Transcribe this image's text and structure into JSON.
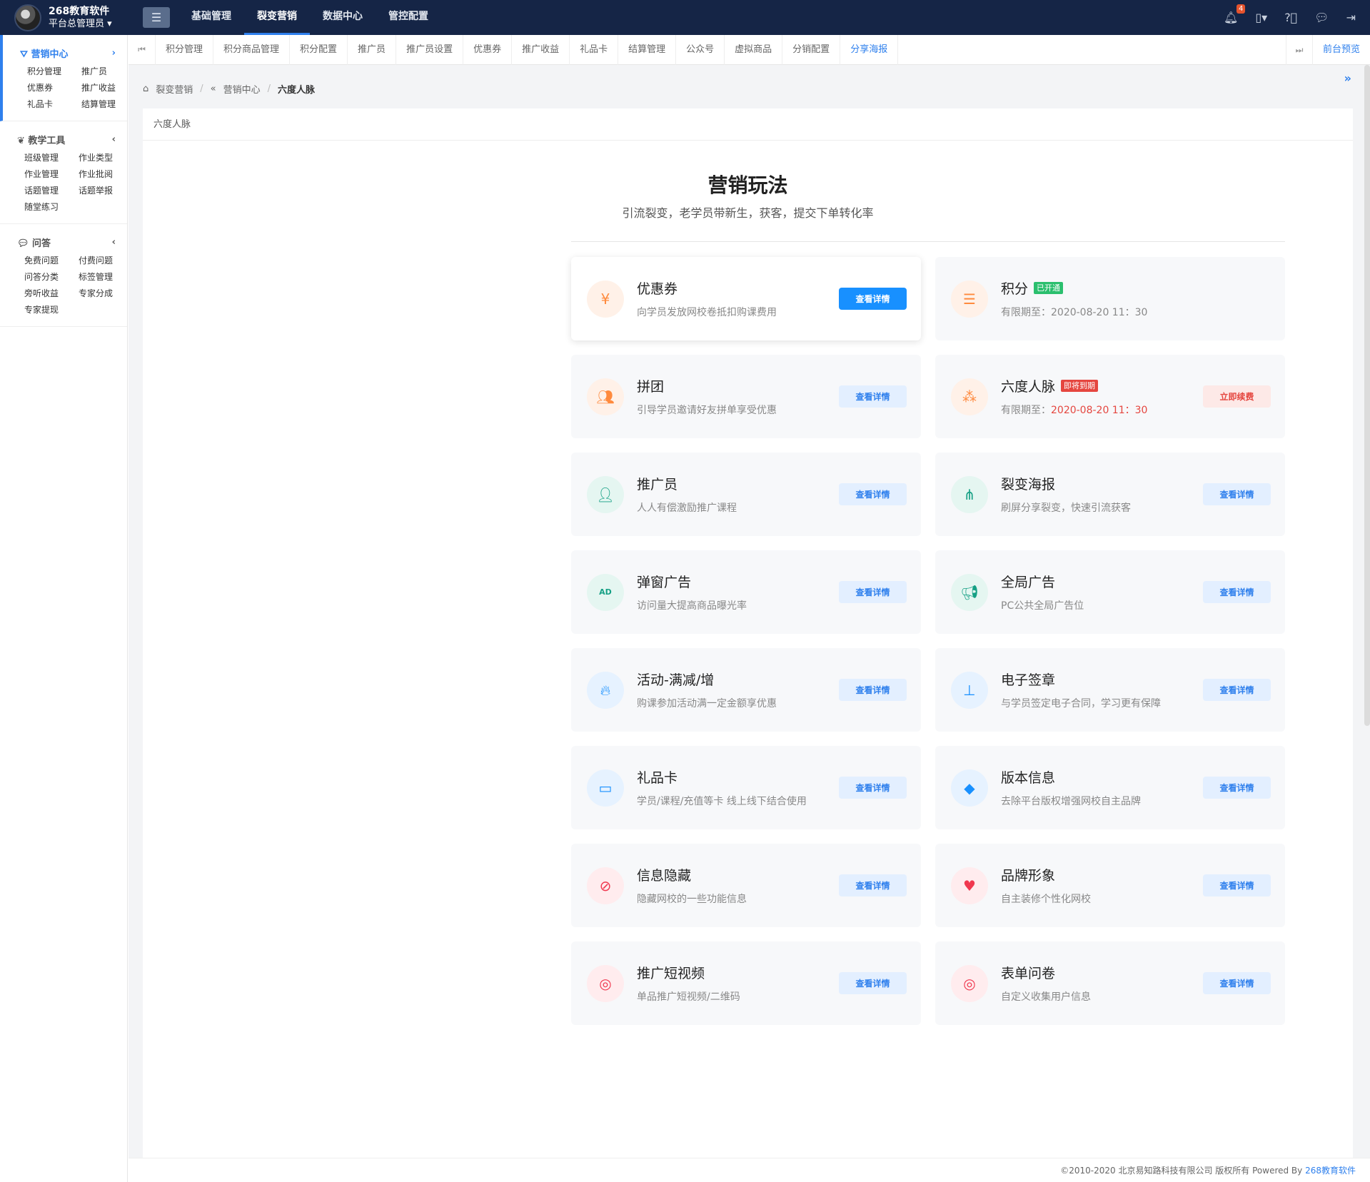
{
  "header": {
    "app_name": "268教育软件",
    "user_role": "平台总管理员",
    "nav": [
      {
        "label": "基础管理",
        "active": false
      },
      {
        "label": "裂变营销",
        "active": true
      },
      {
        "label": "数据中心",
        "active": false
      },
      {
        "label": "管控配置",
        "active": false
      }
    ],
    "notification_count": "4"
  },
  "sidebar": {
    "sections": [
      {
        "title": "营销中心",
        "icon": "funnel-icon",
        "active": true,
        "items": [
          "积分管理",
          "推广员",
          "优惠券",
          "推广收益",
          "礼品卡",
          "结算管理"
        ]
      },
      {
        "title": "教学工具",
        "icon": "leaf-icon",
        "active": false,
        "items": [
          "班级管理",
          "作业类型",
          "作业管理",
          "作业批阅",
          "话题管理",
          "话题举报",
          "随堂练习"
        ]
      },
      {
        "title": "问答",
        "icon": "chat-icon",
        "active": false,
        "items": [
          "免费问题",
          "付费问题",
          "问答分类",
          "标签管理",
          "旁听收益",
          "专家分成",
          "专家提现"
        ]
      }
    ]
  },
  "tabs": {
    "items": [
      "积分管理",
      "积分商品管理",
      "积分配置",
      "推广员",
      "推广员设置",
      "优惠券",
      "推广收益",
      "礼品卡",
      "结算管理",
      "公众号",
      "虚拟商品",
      "分销配置",
      "分享海报"
    ],
    "active_index": 12,
    "preview_label": "前台预览"
  },
  "breadcrumb": {
    "items": [
      "裂变营销",
      "营销中心"
    ],
    "current": "六度人脉"
  },
  "page": {
    "card_title": "六度人脉",
    "heading": "营销玩法",
    "subheading": "引流裂变，老学员带新生，获客，提交下单转化率",
    "cards": [
      {
        "title": "优惠券",
        "desc": "向学员发放网校卷抵扣购课费用",
        "icon": "coupon-icon",
        "color": "orange",
        "button": "查看详情",
        "button_style": "primary"
      },
      {
        "title": "积分",
        "tag": "已开通",
        "tag_color": "green",
        "expire_label": "有限期至：",
        "expire": "2020-08-20 11：30",
        "icon": "coins-icon",
        "color": "orange"
      },
      {
        "title": "拼团",
        "desc": "引导学员邀请好友拼单享受优惠",
        "icon": "group-icon",
        "color": "orange",
        "button": "查看详情"
      },
      {
        "title": "六度人脉",
        "tag": "即将到期",
        "tag_color": "red",
        "expire_label": "有限期至：",
        "expire": "2020-08-20 11：30",
        "expire_red": true,
        "icon": "network-icon",
        "color": "orange",
        "button": "立即续费",
        "button_style": "danger"
      },
      {
        "title": "推广员",
        "desc": "人人有偿激励推广课程",
        "icon": "promoter-icon",
        "color": "green",
        "button": "查看详情"
      },
      {
        "title": "裂变海报",
        "desc": "刷屏分享裂变，快速引流获客",
        "icon": "share-nodes-icon",
        "color": "green",
        "button": "查看详情"
      },
      {
        "title": "弹窗广告",
        "desc": "访问量大提高商品曝光率",
        "icon": "ad-icon",
        "color": "green",
        "button": "查看详情"
      },
      {
        "title": "全局广告",
        "desc": "PC公共全局广告位",
        "icon": "megaphone-icon",
        "color": "green",
        "button": "查看详情"
      },
      {
        "title": "活动-满减/增",
        "desc": "购课参加活动满一定金额享优惠",
        "icon": "flame-icon",
        "color": "blue",
        "button": "查看详情"
      },
      {
        "title": "电子签章",
        "desc": "与学员签定电子合同，学习更有保障",
        "icon": "stamp-icon",
        "color": "blue",
        "button": "查看详情"
      },
      {
        "title": "礼品卡",
        "desc": "学员/课程/充值等卡 线上线下结合使用",
        "icon": "card-icon",
        "color": "blue",
        "button": "查看详情"
      },
      {
        "title": "版本信息",
        "desc": "去除平台版权增强网校自主品牌",
        "icon": "layers-icon",
        "color": "blue",
        "button": "查看详情"
      },
      {
        "title": "信息隐藏",
        "desc": "隐藏网校的一些功能信息",
        "icon": "eye-slash-icon",
        "color": "red",
        "button": "查看详情"
      },
      {
        "title": "品牌形象",
        "desc": "自主装修个性化网校",
        "icon": "heart-icon",
        "color": "red",
        "button": "查看详情"
      },
      {
        "title": "推广短视频",
        "desc": "单品推广短视频/二维码",
        "icon": "target-icon",
        "color": "red",
        "button": "查看详情"
      },
      {
        "title": "表单问卷",
        "desc": "自定义收集用户信息",
        "icon": "target-icon",
        "color": "red",
        "button": "查看详情"
      }
    ]
  },
  "footer": {
    "copyright": "©2010-2020 北京易知路科技有限公司 版权所有 Powered By ",
    "brand_link": "268教育软件"
  }
}
